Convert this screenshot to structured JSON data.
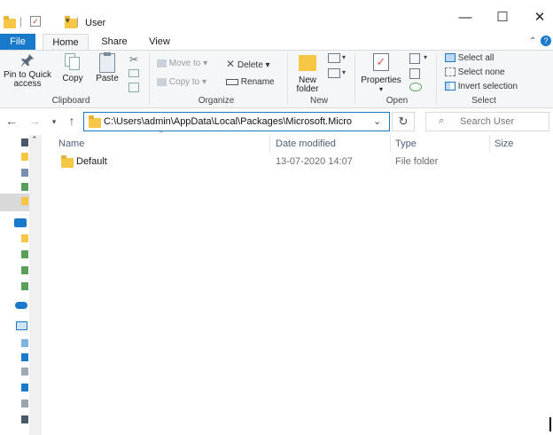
{
  "window": {
    "title": "User",
    "controls": {
      "minimize": "—",
      "maximize": "☐",
      "close": "✕"
    }
  },
  "ribbon": {
    "tabs": [
      "File",
      "Home",
      "Share",
      "View"
    ],
    "help_icon": "?",
    "groups": {
      "clipboard": {
        "label": "Clipboard",
        "pin_to_quick_access": "Pin to Quick access",
        "copy": "Copy",
        "paste": "Paste"
      },
      "organize": {
        "label": "Organize",
        "move_to": "Move to",
        "copy_to": "Copy to",
        "delete": "Delete",
        "rename": "Rename"
      },
      "new": {
        "label": "New",
        "new_folder": "New folder"
      },
      "open": {
        "label": "Open",
        "properties": "Properties"
      },
      "select": {
        "label": "Select",
        "select_all": "Select all",
        "select_none": "Select none",
        "invert_selection": "Invert selection"
      }
    }
  },
  "address_bar": {
    "path": "C:\\Users\\admin\\AppData\\Local\\Packages\\Microsoft.Micro",
    "search_placeholder": "Search User"
  },
  "file_list": {
    "columns": [
      "Name",
      "Date modified",
      "Type",
      "Size"
    ],
    "rows": [
      {
        "name": "Default",
        "date_modified": "13-07-2020 14:07",
        "type": "File folder",
        "size": ""
      }
    ]
  },
  "colors": {
    "accent": "#1979ca",
    "folder": "#f6c744",
    "ribbon_bg": "#f5f6f7"
  }
}
